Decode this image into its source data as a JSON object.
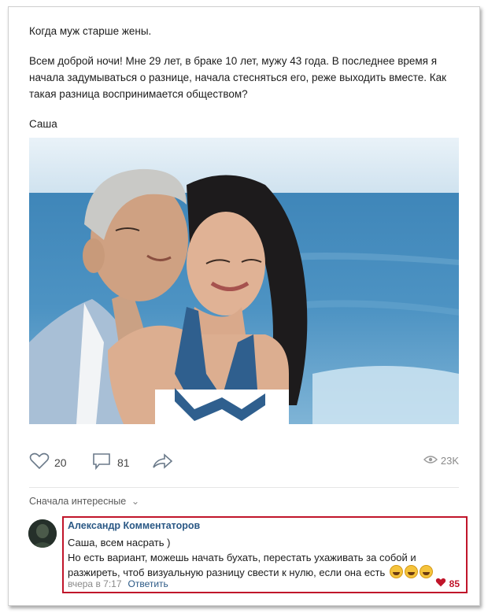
{
  "post": {
    "title": "Когда муж старше жены.",
    "body": "Всем доброй ночи! Мне 29 лет, в браке 10 лет, мужу 43 года. В последнее время я начала задумываться о разнице, начала стесняться его, реже выходить вместе. Как такая разница воспринимается обществом?",
    "signature": "Саша"
  },
  "actions": {
    "likes": "20",
    "comments": "81",
    "views": "23K",
    "icons": [
      "heart-icon",
      "comment-icon",
      "share-icon",
      "eye-icon"
    ]
  },
  "comments_section": {
    "sort_label": "Сначала интересные"
  },
  "comment": {
    "author": "Александр Комментаторов",
    "line1": "Саша, всем насрать )",
    "line2": "Но есть вариант, можешь начать бухать, перестать ухаживать за собой и разжиреть, чтоб визуальную разницу свести к нулю, если она есть",
    "time": "вчера в 7:17",
    "reply_label": "Ответить",
    "likes": "85"
  },
  "colors": {
    "link": "#2a5885",
    "highlight": "#c0152a"
  }
}
